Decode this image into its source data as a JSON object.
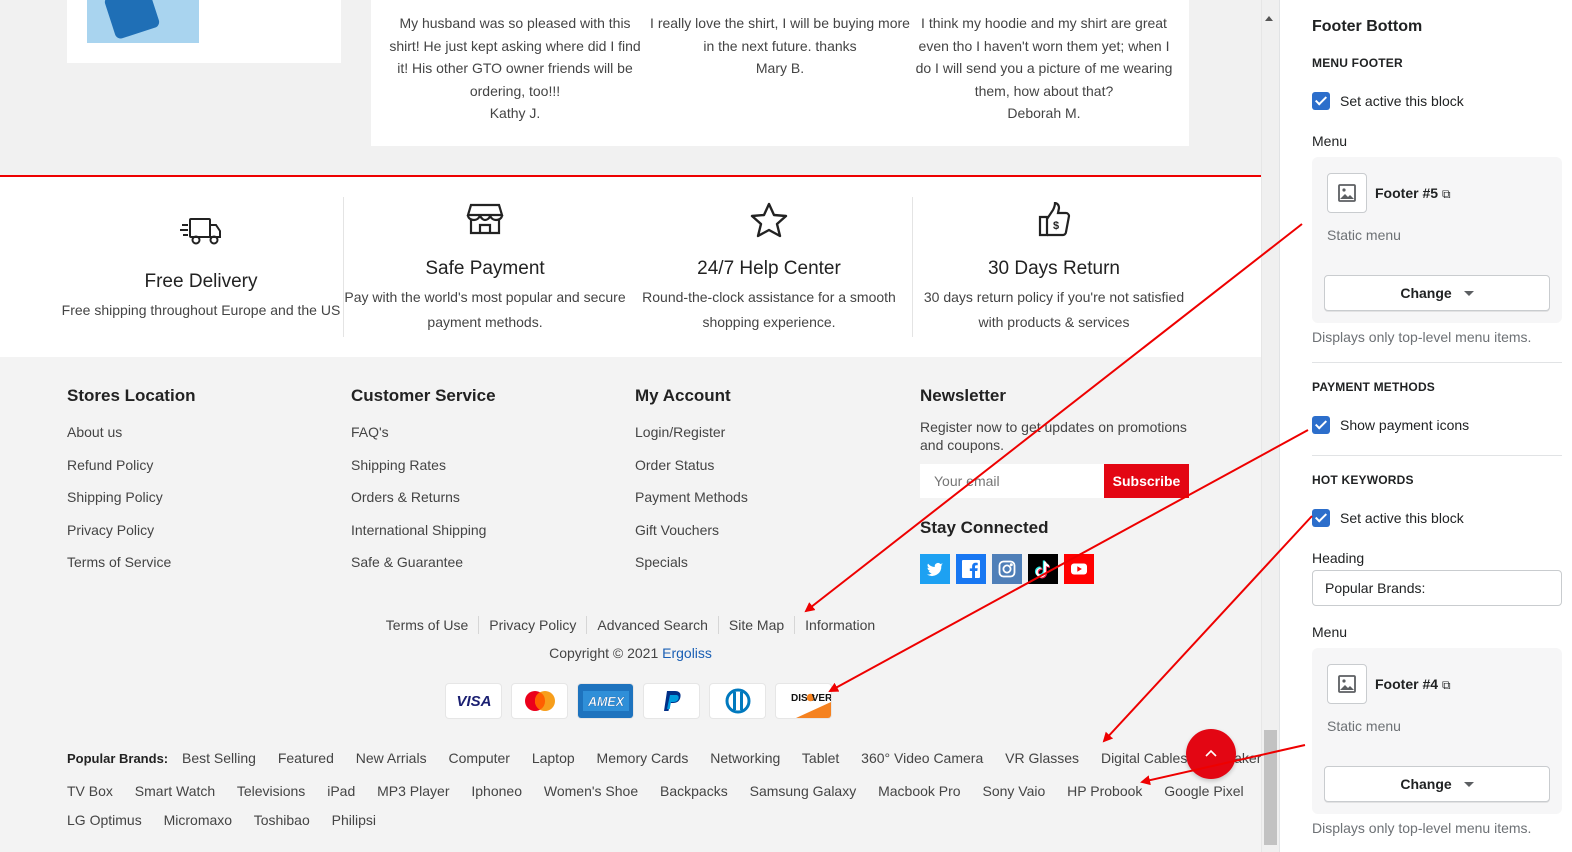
{
  "testimonials": [
    {
      "text": "My husband was so pleased with this shirt! He just kept asking where did I find it! His other GTO owner friends will be ordering, too!!!",
      "author": "Kathy J."
    },
    {
      "text": "I really love the shirt, I will be buying more in the next future. thanks",
      "author": "Mary B."
    },
    {
      "text": "I think my hoodie and my shirt are great even tho I haven't worn them yet; when I do I will send you a picture of me wearing them, how about that?",
      "author": "Deborah M."
    }
  ],
  "features": [
    {
      "icon": "truck-icon",
      "title": "Free Delivery",
      "desc": "Free shipping throughout Europe and the US"
    },
    {
      "icon": "shop-icon",
      "title": "Safe Payment",
      "desc": "Pay with the world's most popular and secure payment methods."
    },
    {
      "icon": "star-icon",
      "title": "24/7 Help Center",
      "desc": "Round-the-clock assistance for a smooth shopping experience."
    },
    {
      "icon": "thumbs-up-dollar-icon",
      "title": "30 Days Return",
      "desc": "30 days return policy if you're not satisfied with products & services"
    }
  ],
  "columns": [
    {
      "title": "Stores Location",
      "links": [
        "About us",
        "Refund Policy",
        "Shipping Policy",
        "Privacy Policy",
        "Terms of Service"
      ]
    },
    {
      "title": "Customer Service",
      "links": [
        "FAQ's",
        "Shipping Rates",
        "Orders & Returns",
        "International Shipping",
        "Safe & Guarantee"
      ]
    },
    {
      "title": "My Account",
      "links": [
        "Login/Register",
        "Order Status",
        "Payment Methods",
        "Gift Vouchers",
        "Specials"
      ]
    }
  ],
  "newsletter": {
    "title": "Newsletter",
    "text": "Register now to get updates on promotions and coupons.",
    "placeholder": "Your email",
    "button": "Subscribe",
    "stay_connected": "Stay Connected",
    "socials": [
      {
        "icon": "twitter-icon",
        "color": "#1da1f2"
      },
      {
        "icon": "facebook-icon",
        "color": "#1877f2"
      },
      {
        "icon": "instagram-icon",
        "color": "#4f7fb8"
      },
      {
        "icon": "tiktok-icon",
        "color": "#000000"
      },
      {
        "icon": "youtube-icon",
        "color": "#ff0000"
      }
    ]
  },
  "menu_footer": [
    "Terms of Use",
    "Privacy Policy",
    "Advanced Search",
    "Site Map",
    "Information"
  ],
  "copyright": {
    "prefix": "Copyright © 2021 ",
    "brand": "Ergoliss"
  },
  "payments": [
    "visa-icon",
    "mastercard-icon",
    "amex-icon",
    "paypal-icon",
    "diners-icon",
    "discover-icon"
  ],
  "brands": {
    "heading": "Popular Brands:",
    "row1": [
      "Best Selling",
      "Featured",
      "New Arrials",
      "Computer",
      "Laptop",
      "Memory Cards",
      "Networking",
      "Tablet",
      "360° Video Camera",
      "VR Glasses",
      "Digital Cables",
      "Speaker"
    ],
    "row2": [
      "TV Box",
      "Smart Watch",
      "Televisions",
      "iPad",
      "MP3 Player",
      "Iphoneo",
      "Women's Shoe",
      "Backpacks",
      "Samsung Galaxy",
      "Macbook Pro",
      "Sony Vaio",
      "HP Probook",
      "Google Pixel"
    ],
    "row3": [
      "LG Optimus",
      "Micromaxo",
      "Toshibao",
      "Philipsi"
    ]
  },
  "panel": {
    "title": "Footer Bottom",
    "menu_footer": {
      "heading": "MENU FOOTER",
      "checkbox": "Set active this block",
      "menu_label": "Menu",
      "menu_name": "Footer #5",
      "menu_sub": "Static menu",
      "change": "Change",
      "help": "Displays only top-level menu items."
    },
    "payment_methods": {
      "heading": "PAYMENT METHODS",
      "checkbox": "Show payment icons"
    },
    "hot_keywords": {
      "heading": "HOT KEYWORDS",
      "checkbox": "Set active this block",
      "heading_label": "Heading",
      "heading_value": "Popular Brands:",
      "menu_label": "Menu",
      "menu_name": "Footer #4",
      "menu_sub": "Static menu",
      "change": "Change",
      "help": "Displays only top-level menu items."
    }
  },
  "accent": "#e30613",
  "panel_accent": "#2c6ecb"
}
